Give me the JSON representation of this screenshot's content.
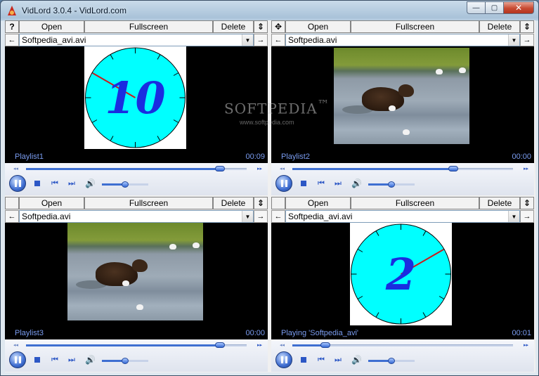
{
  "window": {
    "title": "VidLord 3.0.4 - VidLord.com",
    "min_glyph": "—",
    "max_glyph": "▢",
    "close_glyph": "✕"
  },
  "watermark": {
    "brand": "SOFTPEDIA",
    "tm": "™",
    "url": "www.softpedia.com"
  },
  "toolbar": {
    "open_label": "Open",
    "fullscreen_label": "Fullscreen",
    "delete_label": "Delete",
    "help_label": "?",
    "move_glyph": "✥",
    "swap_glyph": "⇕"
  },
  "nav": {
    "back": "←",
    "forward": "→",
    "dropdown": "▼"
  },
  "controls": {
    "seek_back": "◂◂",
    "seek_forward": "▸▸",
    "prev": "⏮",
    "next": "⏭",
    "volume": "🔊"
  },
  "panes": [
    {
      "file": "Softpedia_avi.avi",
      "label": "Playlist1",
      "time": "00:09",
      "content": "clock",
      "clock_digit": "10",
      "seek_fraction": 0.88,
      "volume_fraction": 0.5,
      "corner_button": "help"
    },
    {
      "file": "Softpedia.avi",
      "label": "Playlist2",
      "time": "00:00",
      "content": "bear",
      "seek_fraction": 0.73,
      "volume_fraction": 0.5,
      "corner_button": "move"
    },
    {
      "file": "Softpedia.avi",
      "label": "Playlist3",
      "time": "00:00",
      "content": "bear",
      "seek_fraction": 0.88,
      "volume_fraction": 0.5,
      "corner_button": "none"
    },
    {
      "file": "Softpedia_avi.avi",
      "label": "Playing 'Softpedia_avi'",
      "time": "00:01",
      "content": "clock",
      "clock_digit": "2",
      "seek_fraction": 0.15,
      "volume_fraction": 0.5,
      "corner_button": "none"
    }
  ],
  "colors": {
    "clock_face": "#00ffff",
    "clock_digit": "#1a2ce0",
    "clock_hand": "#cc1a1a",
    "accent": "#3e6fd1",
    "label": "#7a9cf0"
  }
}
